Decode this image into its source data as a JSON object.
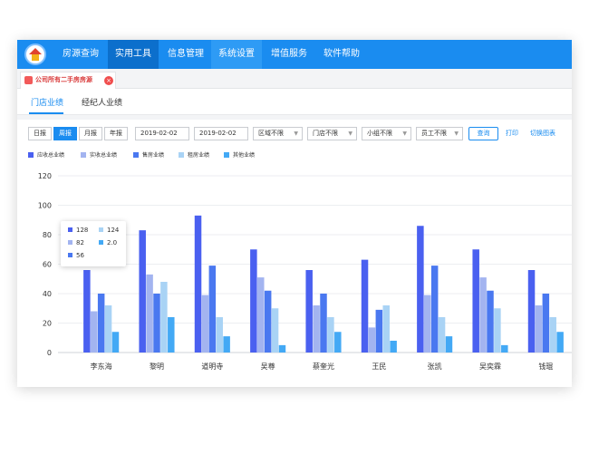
{
  "nav": {
    "items": [
      "房源查询",
      "实用工具",
      "信息管理",
      "系统设置",
      "增值服务",
      "软件帮助"
    ],
    "active_index": 1
  },
  "tabbar": {
    "tab_label": "公司所有二手房房源",
    "close_glyph": "×"
  },
  "subtabs": [
    "门店业绩",
    "经纪人业绩"
  ],
  "filters": {
    "periods": [
      "日报",
      "周报",
      "月报",
      "年报"
    ],
    "active_period": 1,
    "date_from": "2019-02-02",
    "date_to": "2019-02-02",
    "selects": [
      "区域不限",
      "门店不限",
      "小组不限",
      "员工不限"
    ],
    "query_label": "查询",
    "print_label": "打印",
    "switch_label": "切换图表"
  },
  "colors": {
    "brand": "#1a8cf0",
    "series": [
      "#4a60f0",
      "#a3b4f0",
      "#4a78f0",
      "#a9d3f5",
      "#43a9f5"
    ]
  },
  "chart_data": {
    "type": "bar",
    "categories": [
      "李东海",
      "黎明",
      "道明寺",
      "吴尊",
      "蔡奎光",
      "王民",
      "张凯",
      "吴奕霖",
      "钱琨"
    ],
    "series": [
      {
        "name": "应收总业绩",
        "values": [
          56,
          83,
          93,
          70,
          56,
          63,
          86,
          70,
          56
        ]
      },
      {
        "name": "实收总业绩",
        "values": [
          28,
          53,
          39,
          51,
          32,
          17,
          39,
          51,
          32
        ]
      },
      {
        "name": "售房业绩",
        "values": [
          40,
          40,
          59,
          42,
          40,
          29,
          59,
          42,
          40
        ]
      },
      {
        "name": "租房业绩",
        "values": [
          32,
          48,
          24,
          30,
          24,
          32,
          24,
          30,
          24
        ]
      },
      {
        "name": "其他业绩",
        "values": [
          14,
          24,
          11,
          5,
          14,
          8,
          11,
          5,
          14
        ]
      }
    ],
    "ylim": [
      0,
      120
    ],
    "yticks": [
      0,
      20,
      40,
      60,
      80,
      100,
      120
    ],
    "grid": true,
    "legend": "top-left",
    "tooltip": {
      "entries": [
        {
          "value": "128",
          "color": "#4a60f0"
        },
        {
          "value": "124",
          "color": "#a9d3f5"
        },
        {
          "value": "82",
          "color": "#a3b4f0"
        },
        {
          "value": "2.0",
          "color": "#43a9f5"
        },
        {
          "value": "56",
          "color": "#4a78f0"
        }
      ]
    }
  }
}
